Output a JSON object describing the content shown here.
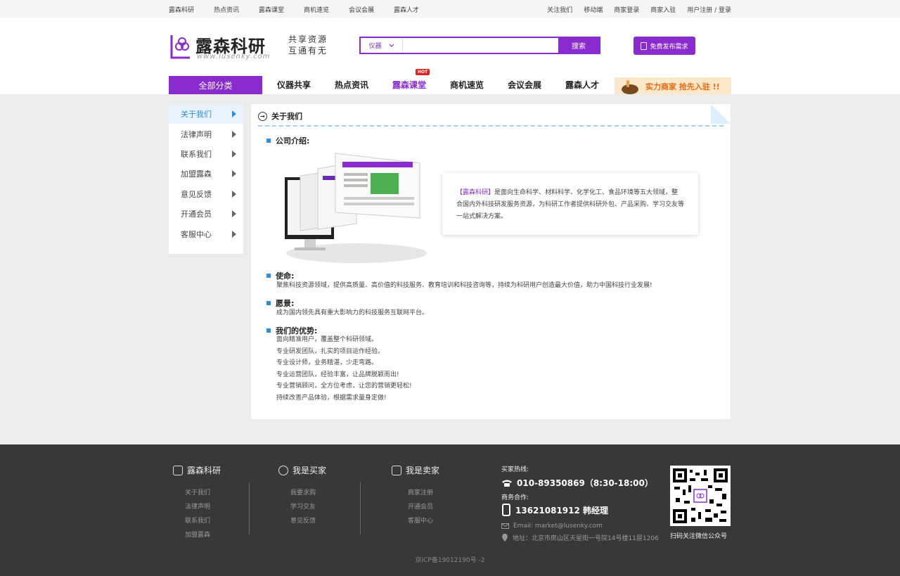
{
  "topbar": {
    "left": [
      "露森科研",
      "热点资讯",
      "露森课堂",
      "商机速览",
      "会议会展",
      "露森人才"
    ],
    "right": [
      "关注我们",
      "移动端",
      "商家登录",
      "商家入驻",
      "用户注册 / 登录"
    ]
  },
  "logo": {
    "name": "露森科研",
    "url": "www.lusenky.com"
  },
  "slogan": {
    "line1": "共享资源",
    "line2": "互通有无"
  },
  "search": {
    "category": "仪器",
    "placeholder": "",
    "button": "搜索"
  },
  "publish": {
    "label": "免费发布需求"
  },
  "nav": {
    "all": "全部分类",
    "items": [
      "仪器共享",
      "热点资讯",
      "露森课堂",
      "商机速览",
      "会议会展",
      "露森人才"
    ],
    "active_index": 2,
    "hot_badge": "HOT",
    "banner": "实力商家  抢先入驻 !!"
  },
  "sidebar": {
    "items": [
      "关于我们",
      "法律声明",
      "联系我们",
      "加盟露森",
      "意见反馈",
      "开通会员",
      "客服中心"
    ],
    "active_index": 0
  },
  "main": {
    "title": "关于我们",
    "intro_heading": "公司介绍:",
    "intro_brand": "【露森科研】",
    "intro_text": "是面向生命科学、材料科学、化学化工、食品环境等五大领域，整合国内外科技研发服务资源，为科研工作者提供科研外包、产品采购、学习交友等一站式解决方案。",
    "mission_heading": "使命:",
    "mission_text": "聚焦科技资源领域，提供高质量、高价值的科技服务、教育培训和科技咨询等，持续为科研用户创造最大价值，助力中国科技行业发展!",
    "vision_heading": "愿景:",
    "vision_text": "成为国内领先具有重大影响力的科技服务互联网平台。",
    "advantage_heading": "我们的优势:",
    "advantages": [
      "面向精准用户，覆盖整个科研领域。",
      "专业研发团队，扎实的项目运作经验。",
      "专业设计师，业务精湛，少走弯路。",
      "专业运营团队，经验丰富，让品牌脱颖而出!",
      "专业营销顾问，全方位考虑，让您的营销更轻松!",
      "持续改善产品体验，根据需求量身定做!"
    ]
  },
  "footer": {
    "col1": {
      "title": "露森科研",
      "links": [
        "关于我们",
        "法律声明",
        "联系我们",
        "加盟露森"
      ]
    },
    "col2": {
      "title": "我是买家",
      "links": [
        "我要求购",
        "学习交友",
        "意见反馈"
      ]
    },
    "col3": {
      "title": "我是卖家",
      "links": [
        "商家注册",
        "开通会员",
        "客服中心"
      ]
    },
    "contact": {
      "hotline_label": "买家热线:",
      "hotline": "010-89350869（8:30-18:00）",
      "biz_label": "商务合作:",
      "biz": "13621081912  韩经理",
      "email": "Email: market@lusenky.com",
      "address": "地址：北京市房山区天星街一号院14号楼11层1206"
    },
    "qr_caption": "扫码关注微信公众号",
    "icp": "京ICP备19012190号 -2"
  },
  "colors": {
    "brand": "#8a2bcf",
    "accent": "#2a8ee0",
    "footer_bg": "#383838"
  }
}
